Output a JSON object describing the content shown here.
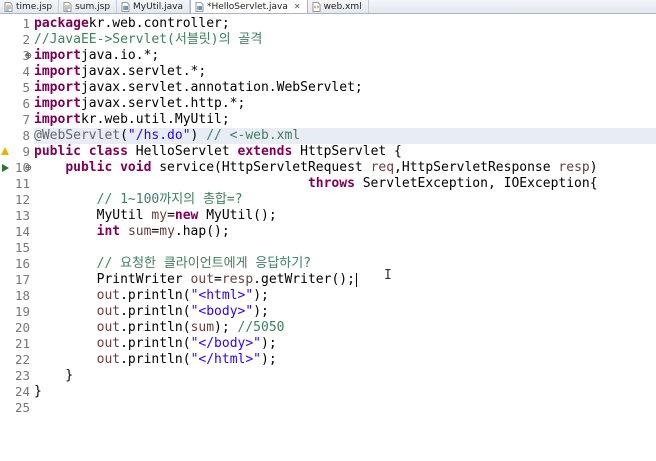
{
  "tabs": [
    {
      "label": "time.jsp",
      "icon": "jsp-file-icon",
      "active": false
    },
    {
      "label": "sum.jsp",
      "icon": "jsp-file-icon",
      "active": false
    },
    {
      "label": "MyUtil.java",
      "icon": "java-file-icon",
      "active": false
    },
    {
      "label": "*HelloServlet.java",
      "icon": "java-file-icon",
      "active": true,
      "close": "✕"
    },
    {
      "label": "web.xml",
      "icon": "xml-file-icon",
      "active": false
    }
  ],
  "editor": {
    "current_line": 8,
    "lines": [
      {
        "n": "1",
        "fold": "",
        "tokens": [
          [
            "kw",
            "package"
          ],
          [
            "",
            "kr.web.controller;"
          ]
        ]
      },
      {
        "n": "2",
        "fold": "",
        "tokens": [
          [
            "cm",
            "//JavaEE->Servlet(서블릿)의 골격"
          ]
        ]
      },
      {
        "n": "3",
        "fold": "⊕",
        "tokens": [
          [
            "kw",
            "import"
          ],
          [
            "",
            "java.io.*;"
          ]
        ]
      },
      {
        "n": "4",
        "fold": "",
        "tokens": [
          [
            "kw",
            "import"
          ],
          [
            "",
            "javax.servlet.*;"
          ]
        ]
      },
      {
        "n": "5",
        "fold": "",
        "tokens": [
          [
            "kw",
            "import"
          ],
          [
            "",
            "javax.servlet.annotation.WebServlet;"
          ]
        ]
      },
      {
        "n": "6",
        "fold": "",
        "tokens": [
          [
            "kw",
            "import"
          ],
          [
            "",
            "javax.servlet.http.*;"
          ]
        ]
      },
      {
        "n": "7",
        "fold": "",
        "tokens": [
          [
            "kw",
            "import"
          ],
          [
            "",
            "kr.web.util.MyUtil;"
          ]
        ]
      },
      {
        "n": "8",
        "fold": "",
        "tokens": [
          [
            "an",
            "@WebServlet"
          ],
          [
            "",
            "("
          ],
          [
            "st",
            "\"/hs.do\""
          ],
          [
            "",
            ") "
          ],
          [
            "cm",
            "// <-web.xml"
          ]
        ]
      },
      {
        "n": "9",
        "fold": "",
        "tokens": [
          [
            "kw",
            "public class "
          ],
          [
            "",
            "HelloServlet "
          ],
          [
            "kw",
            "extends "
          ],
          [
            "",
            "HttpServlet {"
          ]
        ]
      },
      {
        "n": "10",
        "fold": "⊖",
        "tokens": [
          [
            "",
            "    "
          ],
          [
            "kw",
            "public void "
          ],
          [
            "",
            "service(HttpServletRequest "
          ],
          [
            "pr",
            "req"
          ],
          [
            "",
            ",HttpServletResponse "
          ],
          [
            "pr",
            "resp"
          ],
          [
            "",
            ")"
          ]
        ]
      },
      {
        "n": "11",
        "fold": "",
        "tokens": [
          [
            "",
            "                                   "
          ],
          [
            "kw",
            "throws "
          ],
          [
            "",
            "ServletException, IOException{"
          ]
        ]
      },
      {
        "n": "12",
        "fold": "",
        "tokens": [
          [
            "",
            "        "
          ],
          [
            "cm",
            "// 1~100까지의 총합=?"
          ]
        ]
      },
      {
        "n": "13",
        "fold": "",
        "tokens": [
          [
            "",
            "        MyUtil "
          ],
          [
            "pr",
            "my"
          ],
          [
            "",
            "="
          ],
          [
            "kw",
            "new "
          ],
          [
            "",
            "MyUtil();"
          ]
        ]
      },
      {
        "n": "14",
        "fold": "",
        "tokens": [
          [
            "",
            "        "
          ],
          [
            "kw",
            "int "
          ],
          [
            "pr",
            "sum"
          ],
          [
            "",
            "="
          ],
          [
            "pr",
            "my"
          ],
          [
            "",
            ".hap();"
          ]
        ]
      },
      {
        "n": "15",
        "fold": "",
        "tokens": [
          [
            "",
            ""
          ]
        ]
      },
      {
        "n": "16",
        "fold": "",
        "tokens": [
          [
            "",
            "        "
          ],
          [
            "cm",
            "// 요청한 클라이언트에게 응답하기?"
          ]
        ]
      },
      {
        "n": "17",
        "fold": "",
        "tokens": [
          [
            "",
            "        PrintWriter "
          ],
          [
            "pr",
            "out"
          ],
          [
            "",
            "="
          ],
          [
            "pr",
            "resp"
          ],
          [
            "",
            ".getWriter();"
          ]
        ],
        "caret": true
      },
      {
        "n": "18",
        "fold": "",
        "tokens": [
          [
            "",
            "        "
          ],
          [
            "pr",
            "out"
          ],
          [
            "",
            ".println("
          ],
          [
            "st",
            "\"<html>\""
          ],
          [
            "",
            ");"
          ]
        ]
      },
      {
        "n": "19",
        "fold": "",
        "tokens": [
          [
            "",
            "        "
          ],
          [
            "pr",
            "out"
          ],
          [
            "",
            ".println("
          ],
          [
            "st",
            "\"<body>\""
          ],
          [
            "",
            ");"
          ]
        ]
      },
      {
        "n": "20",
        "fold": "",
        "tokens": [
          [
            "",
            "        "
          ],
          [
            "pr",
            "out"
          ],
          [
            "",
            ".println("
          ],
          [
            "pr",
            "sum"
          ],
          [
            "",
            "); "
          ],
          [
            "cm",
            "//5050"
          ]
        ]
      },
      {
        "n": "21",
        "fold": "",
        "tokens": [
          [
            "",
            "        "
          ],
          [
            "pr",
            "out"
          ],
          [
            "",
            ".println("
          ],
          [
            "st",
            "\"</body>\""
          ],
          [
            "",
            ");"
          ]
        ]
      },
      {
        "n": "22",
        "fold": "",
        "tokens": [
          [
            "",
            "        "
          ],
          [
            "pr",
            "out"
          ],
          [
            "",
            ".println("
          ],
          [
            "st",
            "\"</html>\""
          ],
          [
            "",
            ");"
          ]
        ]
      },
      {
        "n": "23",
        "fold": "",
        "tokens": [
          [
            "",
            "    }"
          ]
        ]
      },
      {
        "n": "24",
        "fold": "",
        "tokens": [
          [
            "",
            "}"
          ]
        ]
      },
      {
        "n": "25",
        "fold": "",
        "tokens": [
          [
            "",
            ""
          ]
        ]
      }
    ]
  },
  "colors": {
    "keyword": "#7f0055",
    "comment": "#3f7f5f",
    "string": "#2a00ff",
    "annotation": "#646464",
    "variable": "#6a3e3e",
    "current_line_bg": "#e8ecf5"
  }
}
